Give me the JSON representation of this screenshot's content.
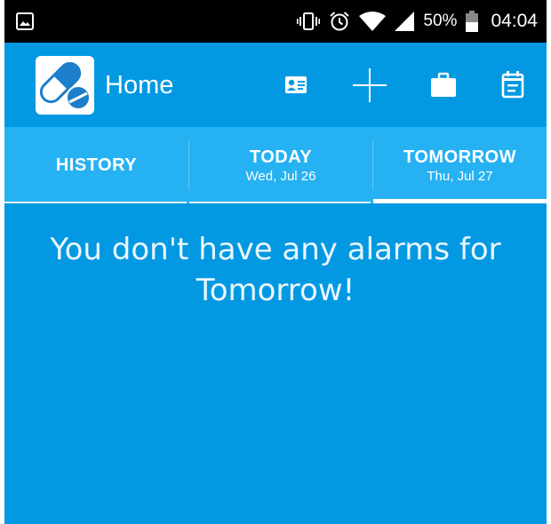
{
  "status_bar": {
    "battery_percent": "50%",
    "time": "04:04",
    "icons": [
      "image-notification-icon",
      "vibrate-icon",
      "alarm-icon",
      "wifi-icon",
      "signal-icon",
      "battery-icon"
    ]
  },
  "app_bar": {
    "title": "Home",
    "logo": "pill-capsule-logo",
    "actions": [
      "contact-card-icon",
      "add-icon",
      "briefcase-icon",
      "calendar-icon"
    ]
  },
  "tabs": [
    {
      "label": "HISTORY",
      "date": ""
    },
    {
      "label": "TODAY",
      "date": "Wed, Jul 26"
    },
    {
      "label": "TOMORROW",
      "date": "Thu, Jul 27"
    }
  ],
  "selected_tab": "TOMORROW",
  "empty_message": {
    "line1": "You don't have any alarms for",
    "line2": "Tomorrow!"
  },
  "colors": {
    "primary": "#0399e2",
    "tab_bar": "#26b1f2",
    "status_bar": "#000000",
    "text": "#ffffff"
  }
}
